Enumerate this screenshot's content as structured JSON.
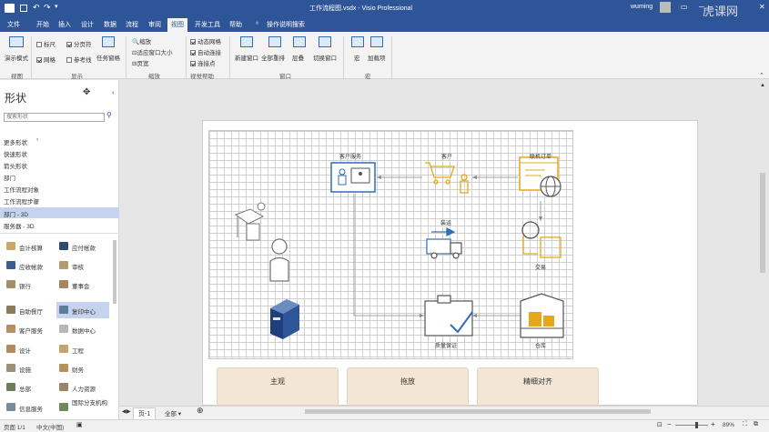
{
  "titlebar": {
    "title": "工作流程图.vsdx - Visio Professional",
    "user": "wuming",
    "watermark": "虎课网"
  },
  "menu": [
    "文件",
    "开始",
    "插入",
    "设计",
    "数据",
    "流程",
    "审阅",
    "视图",
    "开发工具",
    "帮助",
    "操作说明搜索"
  ],
  "menu_active": "视图",
  "ribbon": {
    "presentation_mode": "演示模式",
    "ruler": "标尺",
    "page_breaks": "分页符",
    "grid": "网格",
    "guides": "参考线",
    "task_panes": "任务窗格",
    "zoom": "缩放",
    "fit_window": "适应窗口大小",
    "page_width": "页宽",
    "auto_grid": "动态网格",
    "auto_connect": "自动连接",
    "connection_points": "连接点",
    "new_window": "新建窗口",
    "arrange_all": "全部重排",
    "cascade": "层叠",
    "switch_windows": "切换窗口",
    "macros": "宏",
    "addins": "加载项",
    "groups": [
      "视图",
      "显示",
      "缩放",
      "视觉帮助",
      "窗口",
      "宏"
    ]
  },
  "shapes_panel": {
    "title": "形状",
    "search_placeholder": "搜索形状",
    "categories": [
      "更多形状",
      "快速形状",
      "箭头形状",
      "部门",
      "工作流程对象",
      "工作流程步骤",
      "部门 - 3D",
      "服务器 - 3D"
    ],
    "active_category": "部门 - 3D",
    "items_left": [
      "会计核算",
      "应收帐款",
      "银行",
      "自助餐厅",
      "客户服务",
      "设计",
      "设施",
      "总部",
      "信息服务"
    ],
    "items_right": [
      "应付帐款",
      "审核",
      "董事会",
      "复印中心",
      "数据中心",
      "工程",
      "财务",
      "人力资源",
      "国际分支机构"
    ],
    "selected_item": "复印中心"
  },
  "diagram": {
    "labels": [
      "客户服务",
      "客户",
      "联机订单",
      "装运",
      "交易",
      "质量保证",
      "仓库"
    ],
    "cards": [
      "主观",
      "拖放",
      "精细对齐"
    ]
  },
  "page_tabs": {
    "page": "页-1",
    "all": "全部"
  },
  "statusbar": {
    "page": "页面 1/1",
    "language": "中文(中国)",
    "zoom": "89%"
  }
}
